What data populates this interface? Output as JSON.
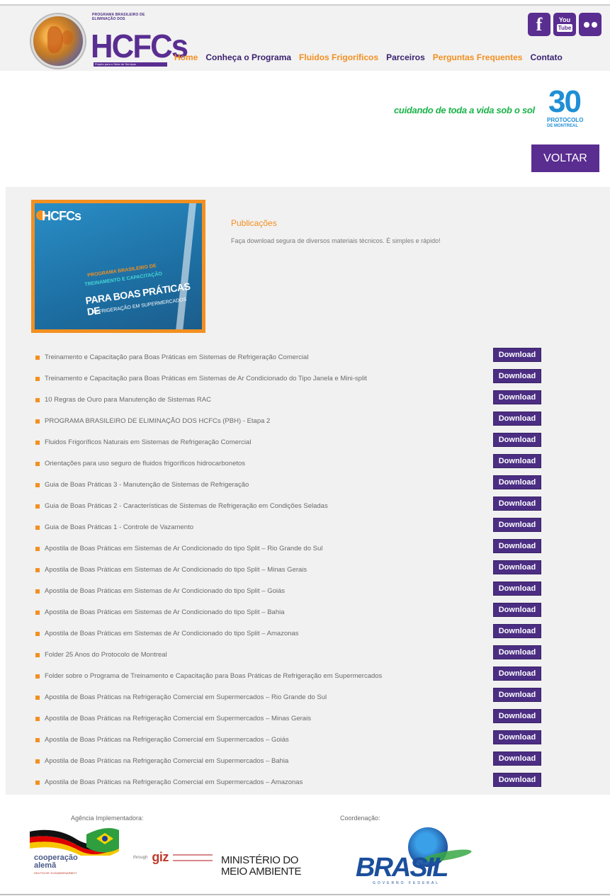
{
  "brand": {
    "small_text": "PROGRAMA BRASILEIRO DE ELIMINAÇÃO DOS",
    "main": "HCFCs",
    "tagline": "Projeto para o Setor de Serviços"
  },
  "social": {
    "facebook": "f",
    "youtube_top": "You",
    "youtube_bottom": "Tube"
  },
  "nav": {
    "items": [
      "Home",
      "Conheça o Programa",
      "Fluidos Frigoríficos",
      "Parceiros",
      "Perguntas Frequentes",
      "Contato"
    ]
  },
  "banner": {
    "slogan": "cuidando de toda a vida sob o sol",
    "badge_number": "30",
    "badge_line1": "PROTOCOLO",
    "badge_line2": "DE MONTREAL",
    "back_button": "VOLTAR"
  },
  "publications": {
    "title": "Publicações",
    "description": "Faça download segura de diversos materiais técnicos. É simples e rápido!",
    "cover": {
      "brand": "HCFCs",
      "line1": "PROGRAMA BRASILEIRO DE",
      "line2": "TREINAMENTO E CAPACITAÇÃO",
      "line3": "PARA BOAS PRÁTICAS DE",
      "line4": "REFRIGERAÇÃO EM SUPERMERCADOS"
    },
    "download_label": "Download",
    "items": [
      "Treinamento e Capacitação para Boas Práticas em Sistemas de Refrigeração Comercial",
      "Treinamento e Capacitação para Boas Práticas em Sistemas de Ar Condicionado do Tipo Janela e Mini-split",
      "10 Regras de Ouro para Manutenção de Sistemas RAC",
      "PROGRAMA BRASILEIRO DE ELIMINAÇÃO DOS HCFCs (PBH) - Etapa 2",
      "Fluidos Frigoríficos Naturais em Sistemas de Refrigeração Comercial",
      "Orientações para uso seguro de fluidos frigoríficos hidrocarbonetos",
      "Guia de Boas Práticas 3 - Manutenção de Sistemas de Refrigeração",
      "Guia de Boas Práticas 2 - Características de Sistemas de Refrigeração em Condições Seladas",
      "Guia de Boas Práticas 1 - Controle de Vazamento",
      "Apostila de Boas Práticas em Sistemas de Ar Condicionado do tipo Split – Rio Grande do Sul",
      "Apostila de Boas Práticas em Sistemas de Ar Condicionado do tipo Split – Minas Gerais",
      "Apostila de Boas Práticas em Sistemas de Ar Condicionado do tipo Split – Goiás",
      "Apostila de Boas Práticas em Sistemas de Ar Condicionado do tipo Split – Bahia",
      "Apostila de Boas Práticas em Sistemas de Ar Condicionado do tipo Split – Amazonas",
      "Folder 25 Anos do Protocolo de Montreal",
      "Folder sobre o Programa de Treinamento e Capacitação para Boas Práticas de Refrigeração em Supermercados",
      "Apostila de Boas Práticas na Refrigeração Comercial em Supermercados – Rio Grande do Sul",
      "Apostila de Boas Práticas na Refrigeração Comercial em Supermercados – Minas Gerais",
      "Apostila de Boas Práticas na Refrigeração Comercial em Supermercados – Goiás",
      "Apostila de Boas Práticas na Refrigeração Comercial em Supermercados – Bahia",
      "Apostila de Boas Práticas na Refrigeração Comercial em Supermercados – Amazonas"
    ]
  },
  "footer": {
    "implementing_label": "Agência Implementadora:",
    "coordination_label": "Coordenação:",
    "coop_line1": "cooperação",
    "coop_line2": "alemã",
    "coop_sub": "DEUTSCHE ZUSAMMENARBEIT",
    "giz_prefix": "through",
    "giz": "giz",
    "mma_line1": "MINISTÉRIO DO",
    "mma_line2": "MEIO AMBIENTE",
    "brasil": "BRASIL",
    "brasil_tag": "GOVERNO FEDERAL"
  },
  "colors": {
    "purple": "#5a2d91",
    "orange": "#f39020",
    "green": "#1bb34a"
  }
}
